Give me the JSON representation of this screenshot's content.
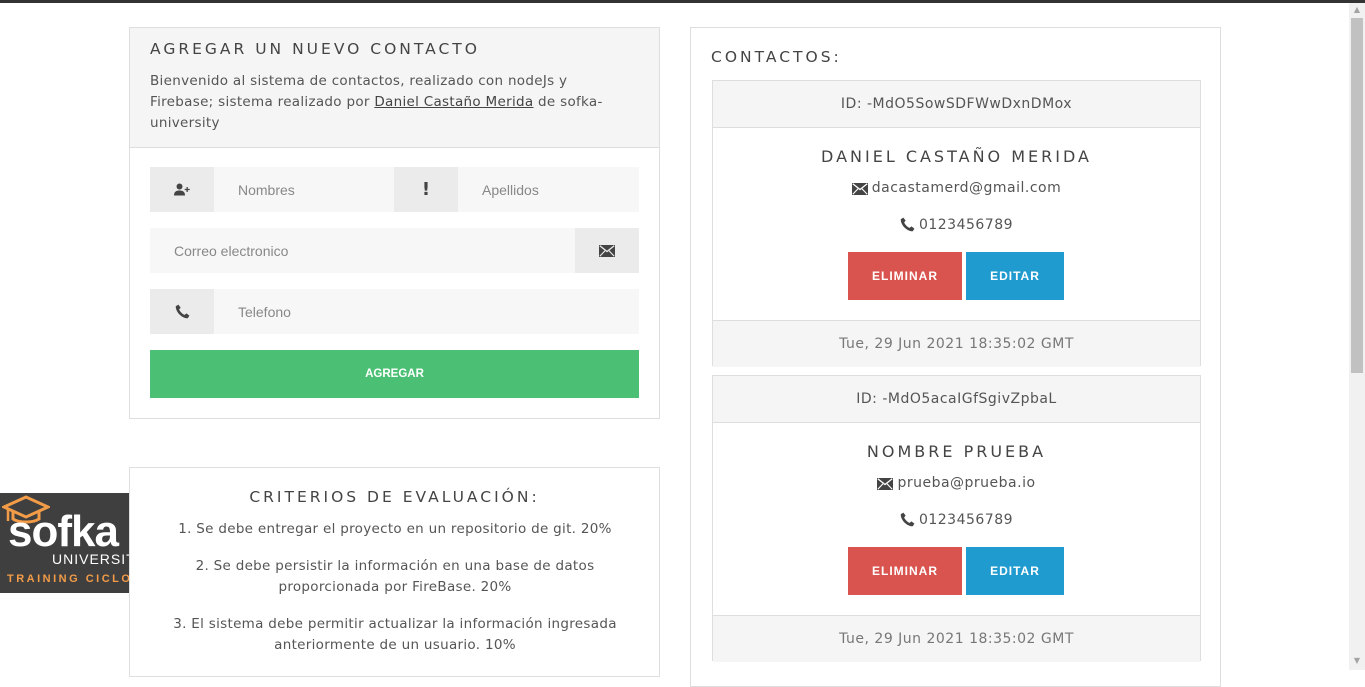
{
  "form": {
    "title": "AGREGAR UN NUEVO CONTACTO",
    "description_prefix": "Bienvenido al sistema de contactos, realizado con nodeJs y Firebase; sistema realizado por ",
    "author_link": "Daniel Castaño Merida",
    "description_suffix": " de sofka-university",
    "nombres_placeholder": "Nombres",
    "apellidos_placeholder": "Apellidos",
    "correo_placeholder": "Correo electronico",
    "telefono_placeholder": "Telefono",
    "apellidos_icon_glyph": "!",
    "add_button": "AGREGAR"
  },
  "criteria": {
    "title": "CRITERIOS DE EVALUACIÓN:",
    "items": [
      "1. Se debe entregar el proyecto en un repositorio de git. 20%",
      "2. Se debe persistir la información en una base de datos proporcionada por FireBase. 20%",
      "3. El sistema debe permitir actualizar la información ingresada anteriormente de un usuario. 10%"
    ]
  },
  "logo": {
    "brand": "sofka",
    "sub": "UNIVERSITY",
    "tagline": "TRAINING CICLO"
  },
  "contacts": {
    "title": "CONTACTOS:",
    "delete_label": "ELIMINAR",
    "edit_label": "EDITAR",
    "items": [
      {
        "id": "ID: -MdO5SowSDFWwDxnDMox",
        "name": "DANIEL CASTAÑO MERIDA",
        "email": "dacastamerd@gmail.com",
        "phone": "0123456789",
        "date": "Tue, 29 Jun 2021 18:35:02 GMT"
      },
      {
        "id": "ID: -MdO5acaIGfSgivZpbaL",
        "name": "NOMBRE PRUEBA",
        "email": "prueba@prueba.io",
        "phone": "0123456789",
        "date": "Tue, 29 Jun 2021 18:35:02 GMT"
      }
    ]
  },
  "colors": {
    "success": "#4bbf73",
    "danger": "#d9534f",
    "info": "#1f9bcf",
    "logo_accent": "#f39c48"
  }
}
